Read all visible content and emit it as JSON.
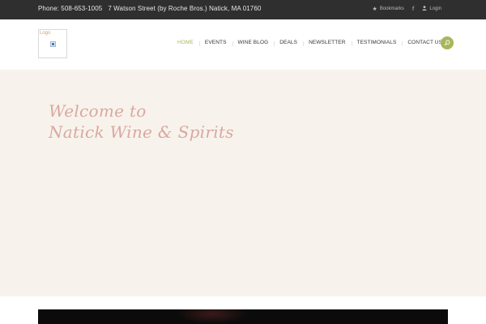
{
  "topbar": {
    "phone": "Phone: 508-653-1005",
    "address": "7 Watson Street (by Roche Bros.) Natick, MA 01760",
    "bookmarks_label": "Bookmarks",
    "login_label": "Login",
    "facebook_glyph": "f"
  },
  "header": {
    "logo_alt": "Logo",
    "nav": {
      "home": "HOME",
      "events": "EVENTS",
      "wine_blog": "WINE BLOG",
      "deals": "DEALS",
      "newsletter": "NEWSLETTER",
      "testimonials": "TESTIMONIALS",
      "contact_us": "CONTACT US"
    },
    "active_nav": "home"
  },
  "hero": {
    "line1": "Welcome to",
    "line2": "Natick Wine & Spirits"
  },
  "colors": {
    "topbar_bg": "#2f2f2f",
    "accent": "#a9b65a",
    "hero_bg": "#f7f3ec",
    "hero_text": "#d9a8a0"
  },
  "icons": {
    "bookmarks": "star-icon",
    "login": "user-icon",
    "facebook": "facebook-icon",
    "search": "search-icon"
  }
}
